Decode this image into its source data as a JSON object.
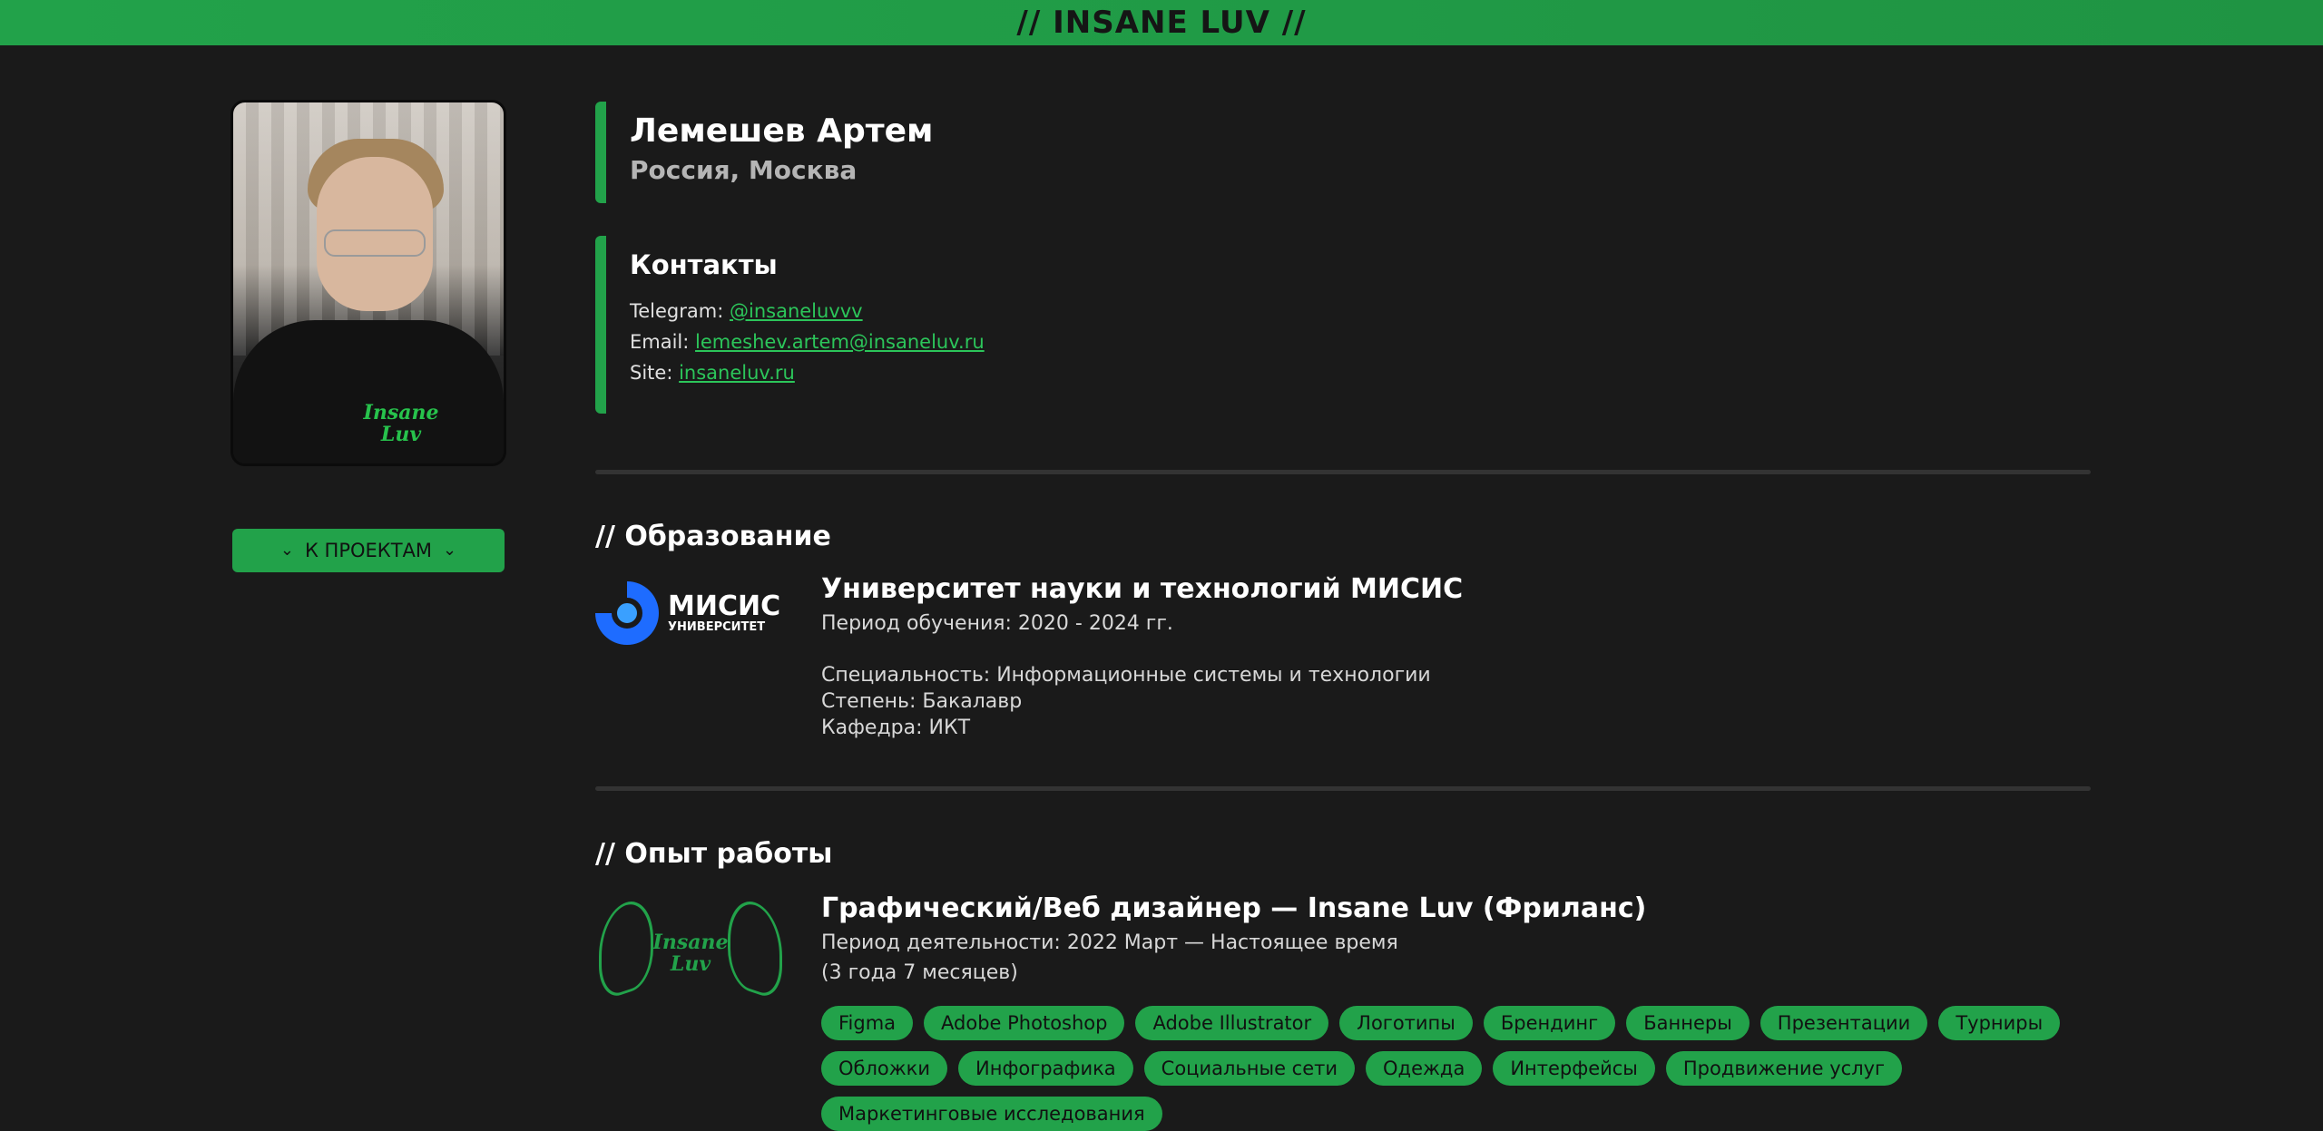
{
  "header": {
    "title": "// INSANE LUV //"
  },
  "sidebar": {
    "projects_button": "К ПРОЕКТАМ",
    "photo_logo_text": [
      "Insane",
      "Luv"
    ]
  },
  "profile": {
    "name": "Лемешев Артем",
    "location": "Россия, Москва"
  },
  "contacts": {
    "title": "Контакты",
    "telegram_label": "Telegram:",
    "telegram_value": "@insaneluvvv",
    "email_label": "Email:",
    "email_value": "lemeshev.artem@insaneluv.ru",
    "site_label": "Site:",
    "site_value": "insaneluv.ru"
  },
  "education": {
    "section_title": "// Образование",
    "logo_main": "МИСИС",
    "logo_sub": "УНИВЕРСИТЕТ",
    "university": "Университет науки и технологий МИСИС",
    "period": "Период обучения: 2020 - 2024 гг.",
    "specialty": "Специальность: Информационные системы и технологии",
    "degree": "Степень: Бакалавр",
    "department": "Кафедра: ИКТ"
  },
  "work": {
    "section_title": "// Опыт работы",
    "logo_text": [
      "Insane",
      "Luv"
    ],
    "title": "Графический/Веб дизайнер — Insane Luv (Фриланс)",
    "period": "Период деятельности: 2022 Март — Настоящее время",
    "duration": "(3 года 7 месяцев)",
    "tags": [
      "Figma",
      "Adobe Photoshop",
      "Adobe Illustrator",
      "Логотипы",
      "Брендинг",
      "Баннеры",
      "Презентации",
      "Турниры",
      "Обложки",
      "Инфографика",
      "Социальные сети",
      "Одежда",
      "Интерфейсы",
      "Продвижение услуг",
      "Маркетинговые исследования"
    ]
  },
  "colors": {
    "accent": "#22a24a",
    "background": "#1a1a1a",
    "link": "#2cc55a"
  }
}
